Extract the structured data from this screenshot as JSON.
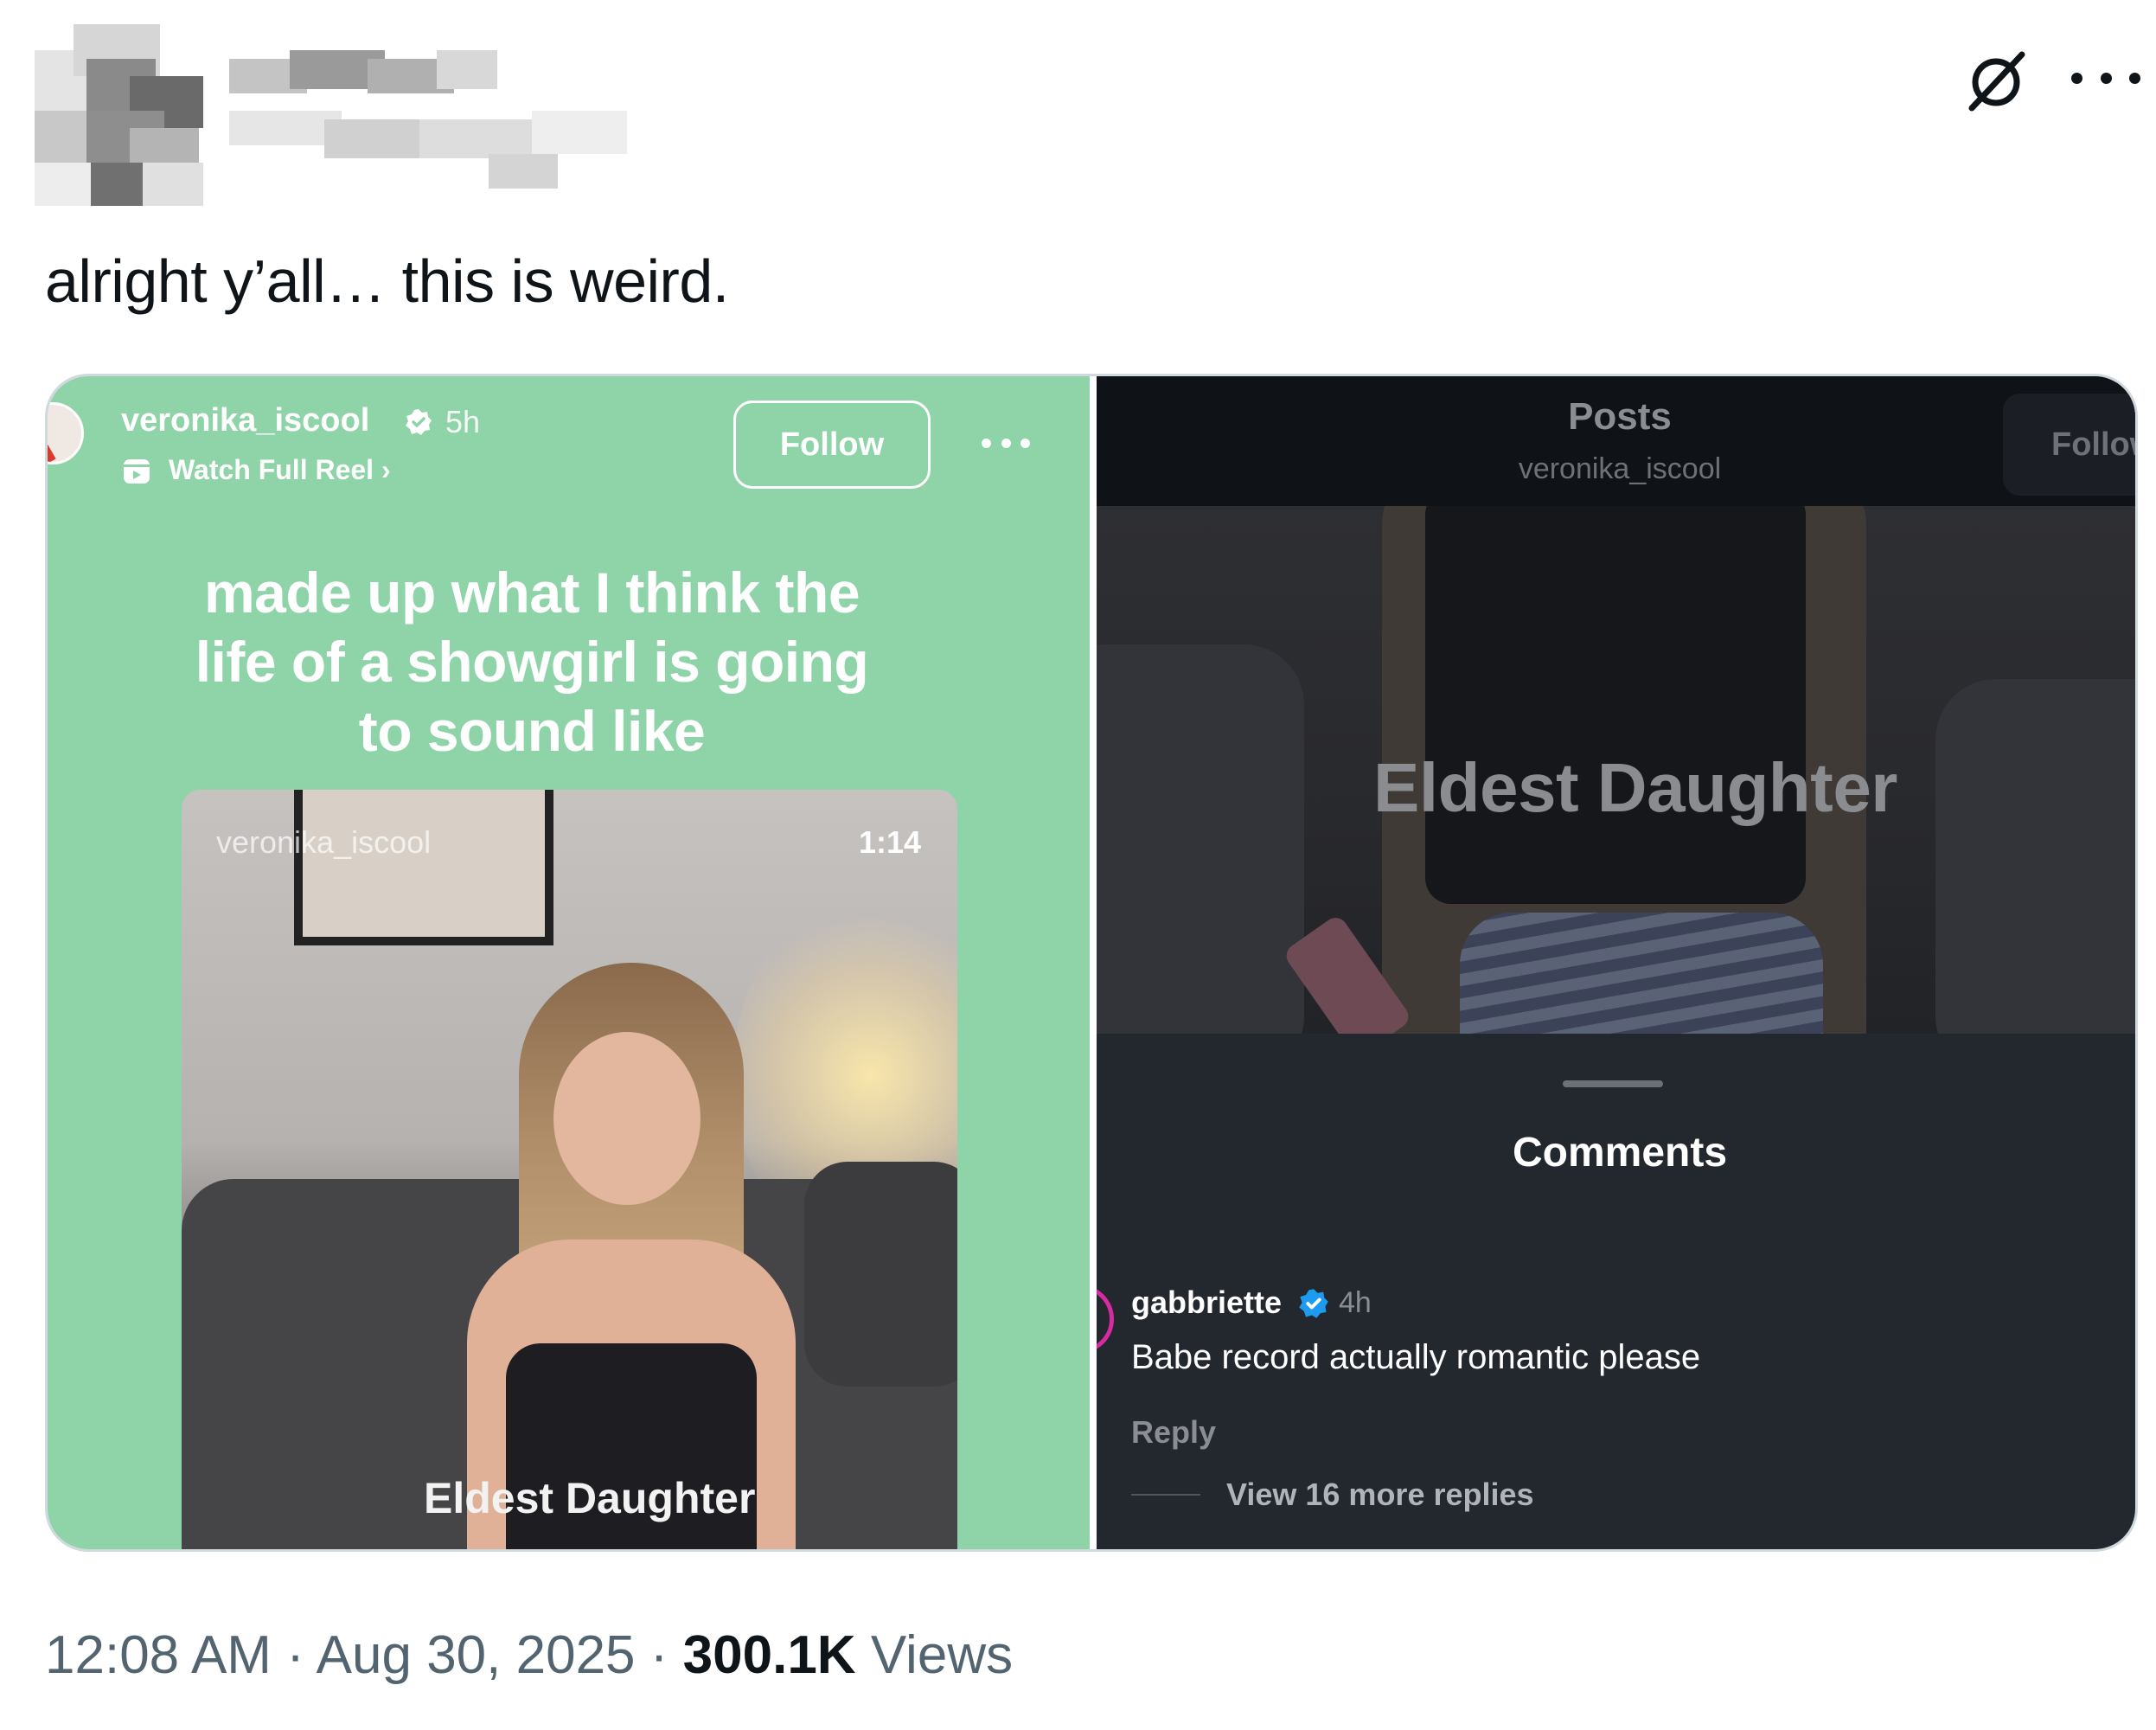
{
  "tweet": {
    "text": "alright y’all… this is weird.",
    "time": "12:08 AM",
    "separator": " · ",
    "date": "Aug 30, 2025",
    "views_count": "300.1K",
    "views_label": "Views"
  },
  "left_panel": {
    "username": "veronika_iscool",
    "time_ago": "5h",
    "watch_reel": "Watch Full Reel ›",
    "follow_label": "Follow",
    "caption": "made up what I think the life of a showgirl is going to sound like",
    "video_username": "veronika_iscool",
    "video_duration": "1:14",
    "video_overlay": "Eldest Daughter",
    "background_color": "#8fd4a8"
  },
  "right_panel": {
    "header_title": "Posts",
    "header_username": "veronika_iscool",
    "follow_label": "Follow",
    "video_overlay": "Eldest Daughter",
    "comments_title": "Comments",
    "comment": {
      "username": "gabbriette",
      "time_ago": "4h",
      "text": "Babe record actually romantic please",
      "reply_label": "Reply",
      "more_replies": "View 16 more replies"
    }
  },
  "icons": {
    "grok": "grok-icon",
    "more": "more-options-icon",
    "verified": "verified-badge-icon",
    "reel": "reel-icon"
  },
  "colors": {
    "text_primary": "#0f1419",
    "text_secondary": "#536471",
    "verified_blue": "#1d9bf0",
    "comment_ring": "#d72ba1"
  }
}
